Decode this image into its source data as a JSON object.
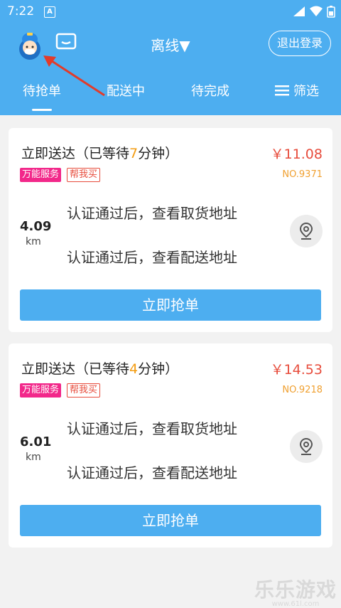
{
  "status_bar": {
    "time": "7:22",
    "notification": "A"
  },
  "header": {
    "title": "离线▼",
    "logout_label": "退出登录",
    "tabs": [
      {
        "label": "待抢单"
      },
      {
        "label": "配送中"
      },
      {
        "label": "待完成"
      },
      {
        "label": "筛选"
      }
    ]
  },
  "orders": [
    {
      "title_prefix": "立即送达（已等待",
      "wait": "7",
      "title_suffix": "分钟）",
      "price": "￥11.08",
      "tags": [
        "万能服务",
        "帮我买"
      ],
      "order_no": "NO.9371",
      "distance": "4.09",
      "distance_unit": "km",
      "pickup": "认证通过后，查看取货地址",
      "delivery": "认证通过后，查看配送地址",
      "action": "立即抢单"
    },
    {
      "title_prefix": "立即送达（已等待",
      "wait": "4",
      "title_suffix": "分钟）",
      "price": "￥14.53",
      "tags": [
        "万能服务",
        "帮我买"
      ],
      "order_no": "NO.9218",
      "distance": "6.01",
      "distance_unit": "km",
      "pickup": "认证通过后，查看取货地址",
      "delivery": "认证通过后，查看配送地址",
      "action": "立即抢单"
    }
  ],
  "watermark": {
    "main": "乐乐游戏",
    "sub": "www.61l.com"
  },
  "colors": {
    "primary": "#4daef0",
    "price": "#e74c3c",
    "accent": "#f39c12",
    "tag": "#f2288a"
  }
}
